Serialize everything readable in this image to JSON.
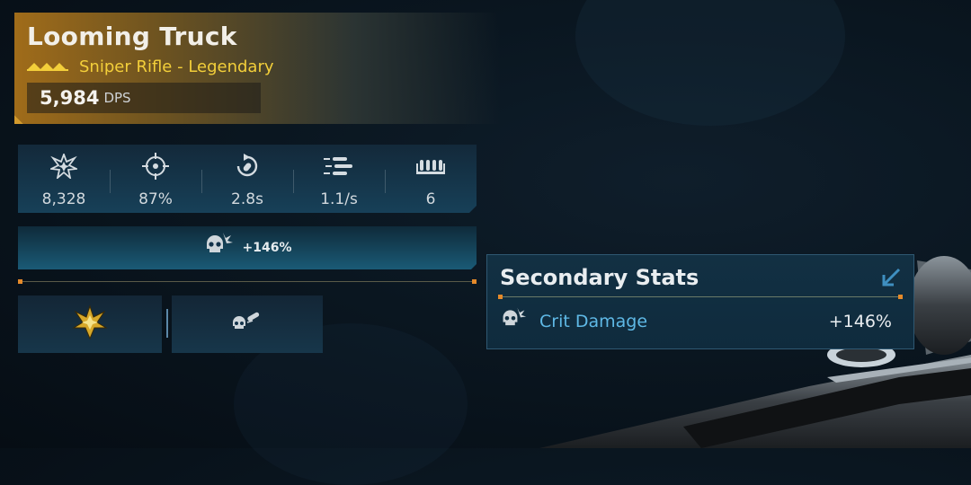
{
  "weapon": {
    "name": "Looming Truck",
    "type_rarity": "Sniper Rifle - Legendary",
    "dps_value": "5,984",
    "dps_label": "DPS"
  },
  "primary_stats": [
    {
      "icon": "damage-burst-icon",
      "value": "8,328"
    },
    {
      "icon": "accuracy-crosshair-icon",
      "value": "87%"
    },
    {
      "icon": "reload-icon",
      "value": "2.8s"
    },
    {
      "icon": "fire-rate-icon",
      "value": "1.1/s"
    },
    {
      "icon": "magazine-icon",
      "value": "6"
    }
  ],
  "crit_bar": {
    "icon": "crit-skull-icon",
    "value": "+146%"
  },
  "mod_slots": [
    {
      "icon": "legendary-badge-icon"
    },
    {
      "icon": "skull-bullet-icon"
    }
  ],
  "secondary": {
    "title": "Secondary Stats",
    "rows": [
      {
        "icon": "crit-skull-icon",
        "name": "Crit Damage",
        "value": "+146%"
      }
    ]
  },
  "colors": {
    "legendary_gold": "#f3cf3a",
    "stat_blue": "#5fb9e6",
    "accent_orange": "#e58a2a"
  }
}
